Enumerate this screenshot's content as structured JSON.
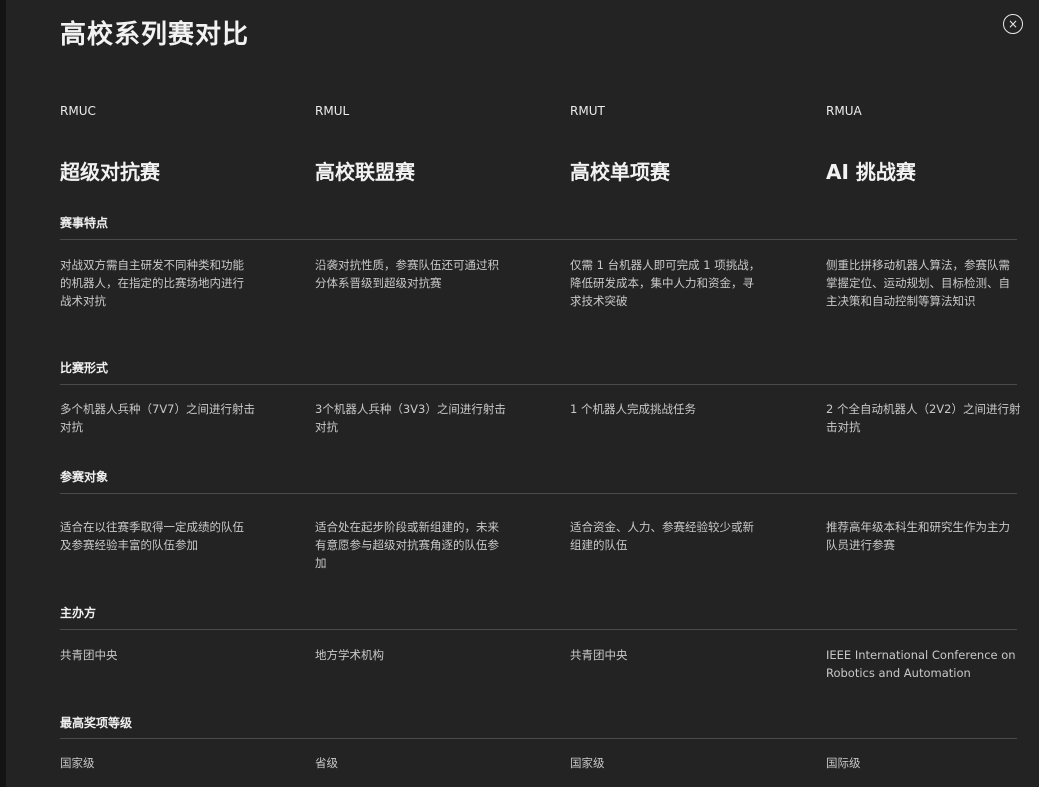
{
  "page": {
    "title": "高校系列赛对比",
    "close_label": "×"
  },
  "columns": [
    {
      "code": "RMUC",
      "name": "超级对抗赛"
    },
    {
      "code": "RMUL",
      "name": "高校联盟赛"
    },
    {
      "code": "RMUT",
      "name": "高校单项赛"
    },
    {
      "code": "RMUA",
      "name": "AI 挑战赛"
    }
  ],
  "sections": [
    {
      "heading": "赛事特点",
      "cells": [
        "对战双方需自主研发不同种类和功能的机器人，在指定的比赛场地内进行战术对抗",
        "沿袭对抗性质，参赛队伍还可通过积分体系晋级到超级对抗赛",
        "仅需 1 台机器人即可完成 1 项挑战，降低研发成本，集中人力和资金，寻求技术突破",
        "侧重比拼移动机器人算法，参赛队需掌握定位、运动规划、目标检测、自主决策和自动控制等算法知识"
      ]
    },
    {
      "heading": "比赛形式",
      "cells": [
        "多个机器人兵种（7V7）之间进行射击对抗",
        "3个机器人兵种（3V3）之间进行射击对抗",
        "1 个机器人完成挑战任务",
        "2 个全自动机器人（2V2）之间进行射击对抗"
      ]
    },
    {
      "heading": "参赛对象",
      "cells": [
        "适合在以往赛季取得一定成绩的队伍及参赛经验丰富的队伍参加",
        "适合处在起步阶段或新组建的，未来有意愿参与超级对抗赛角逐的队伍参加",
        "适合资金、人力、参赛经验较少或新组建的队伍",
        "推荐高年级本科生和研究生作为主力队员进行参赛"
      ]
    },
    {
      "heading": "主办方",
      "cells": [
        "共青团中央",
        "地方学术机构",
        "共青团中央",
        "IEEE International Conference on Robotics and Automation"
      ]
    },
    {
      "heading": "最高奖项等级",
      "cells": [
        "国家级",
        "省级",
        "国家级",
        "国际级"
      ]
    }
  ]
}
